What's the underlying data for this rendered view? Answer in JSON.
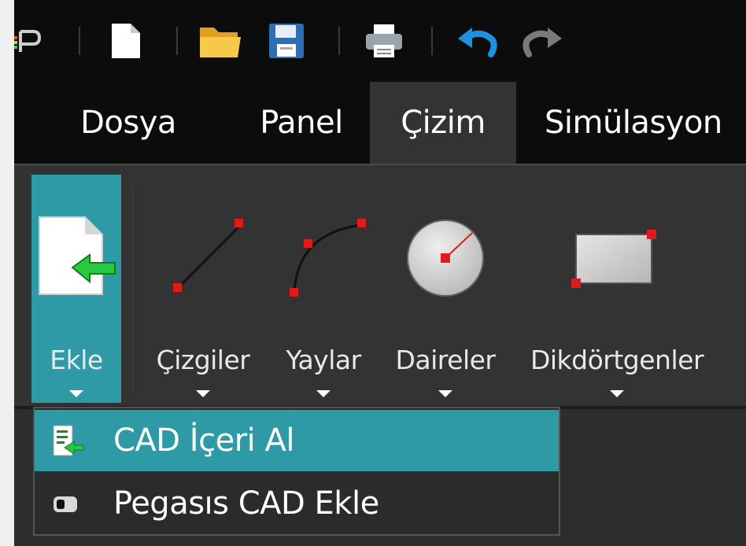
{
  "quick_access": {
    "icons": [
      "app-logo-icon",
      "new-file-icon",
      "open-folder-icon",
      "save-icon",
      "print-icon",
      "undo-icon",
      "redo-icon"
    ]
  },
  "tabs": [
    {
      "label": "Dosya",
      "active": false
    },
    {
      "label": "Panel",
      "active": false
    },
    {
      "label": "Çizim",
      "active": true
    },
    {
      "label": "Simülasyon",
      "active": false
    }
  ],
  "ribbon": {
    "buttons": [
      {
        "label": "Ekle",
        "icon": "import-document-icon",
        "highlighted": true
      },
      {
        "label": "Çizgiler",
        "icon": "line-icon",
        "highlighted": false
      },
      {
        "label": "Yaylar",
        "icon": "arc-icon",
        "highlighted": false
      },
      {
        "label": "Daireler",
        "icon": "circle-icon",
        "highlighted": false
      },
      {
        "label": "Dikdörtgenler",
        "icon": "rectangle-icon",
        "highlighted": false
      }
    ]
  },
  "dropdown": {
    "items": [
      {
        "label": "CAD İçeri Al",
        "icon": "cad-import-icon",
        "highlighted": true
      },
      {
        "label": "Pegasıs CAD Ekle",
        "icon": "pegasis-cad-icon",
        "highlighted": false
      }
    ]
  },
  "colors": {
    "accent": "#2e9aa6",
    "titlebar": "#0c0c0c",
    "ribbon": "#333333"
  }
}
